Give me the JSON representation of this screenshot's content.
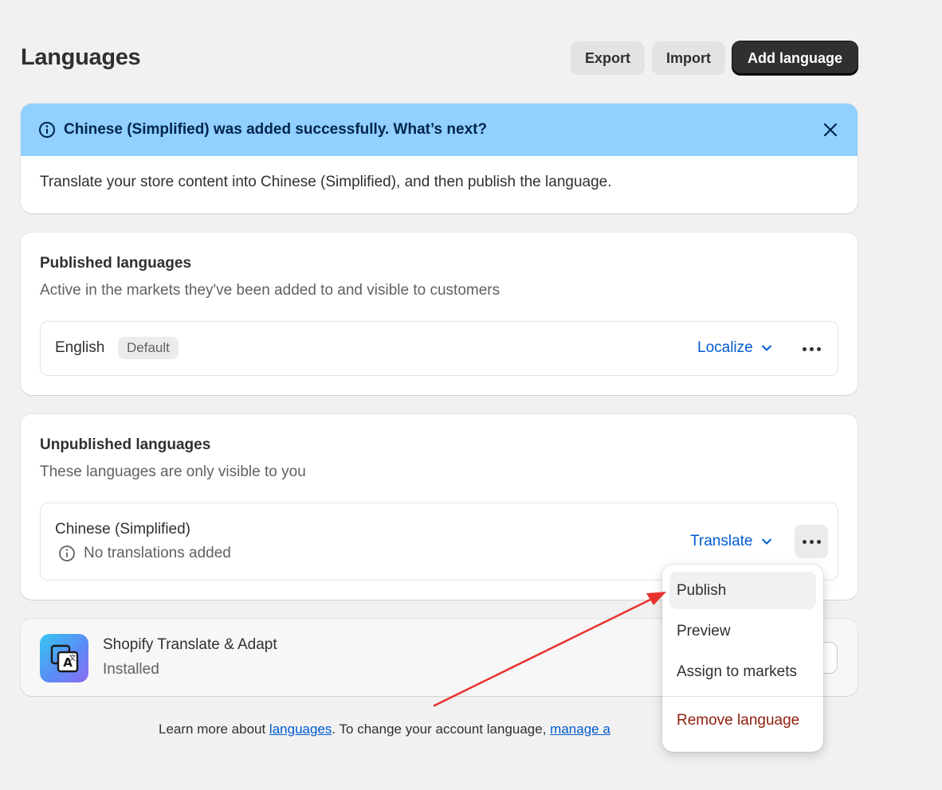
{
  "header": {
    "title": "Languages",
    "export_label": "Export",
    "import_label": "Import",
    "add_label": "Add language"
  },
  "banner": {
    "title": "Chinese (Simplified) was added successfully. What’s next?",
    "body": "Translate your store content into Chinese (Simplified), and then publish the language.",
    "color": "#91d0ff"
  },
  "published": {
    "title": "Published languages",
    "subtitle": "Active in the markets they've been added to and visible to customers",
    "languages": [
      {
        "name": "English",
        "badge": "Default",
        "action": "Localize"
      }
    ]
  },
  "unpublished": {
    "title": "Unpublished languages",
    "subtitle": "These languages are only visible to you",
    "languages": [
      {
        "name": "Chinese (Simplified)",
        "status": "No translations added",
        "action": "Translate"
      }
    ]
  },
  "app": {
    "name": "Shopify Translate & Adapt",
    "status": "Installed",
    "icon": "translate-app-icon"
  },
  "footer": {
    "prefix": "Learn more about ",
    "link1": "languages",
    "middle": ". To change your account language, ",
    "link2": "manage a"
  },
  "menu": {
    "items": [
      "Publish",
      "Preview",
      "Assign to markets"
    ],
    "danger_item": "Remove language"
  },
  "colors": {
    "link": "#005bd3",
    "primary_button": "#303030",
    "danger": "#8e1f0b",
    "annotation_arrow": "#e8322f"
  }
}
